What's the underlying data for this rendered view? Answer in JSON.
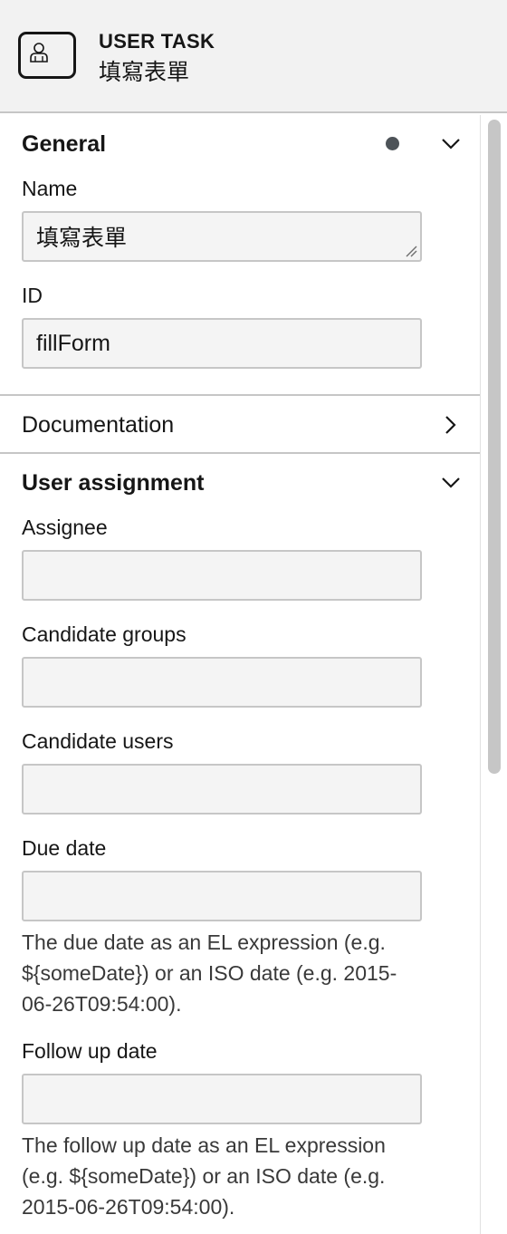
{
  "header": {
    "element_type": "USER TASK",
    "element_name": "填寫表單",
    "icon": "user-task-icon"
  },
  "general": {
    "title": "General",
    "name_label": "Name",
    "name_value": "填寫表單",
    "id_label": "ID",
    "id_value": "fillForm"
  },
  "documentation": {
    "title": "Documentation"
  },
  "user_assignment": {
    "title": "User assignment",
    "assignee_label": "Assignee",
    "assignee_value": "",
    "candidate_groups_label": "Candidate groups",
    "candidate_groups_value": "",
    "candidate_users_label": "Candidate users",
    "candidate_users_value": "",
    "due_date_label": "Due date",
    "due_date_value": "",
    "due_date_desc": "The due date as an EL expression (e.g. ${someDate}) or an ISO date (e.g. 2015-06-26T09:54:00).",
    "follow_up_label": "Follow up date",
    "follow_up_value": "",
    "follow_up_desc": "The follow up date as an EL expression (e.g. ${someDate}) or an ISO date (e.g. 2015-06-26T09:54:00)."
  }
}
